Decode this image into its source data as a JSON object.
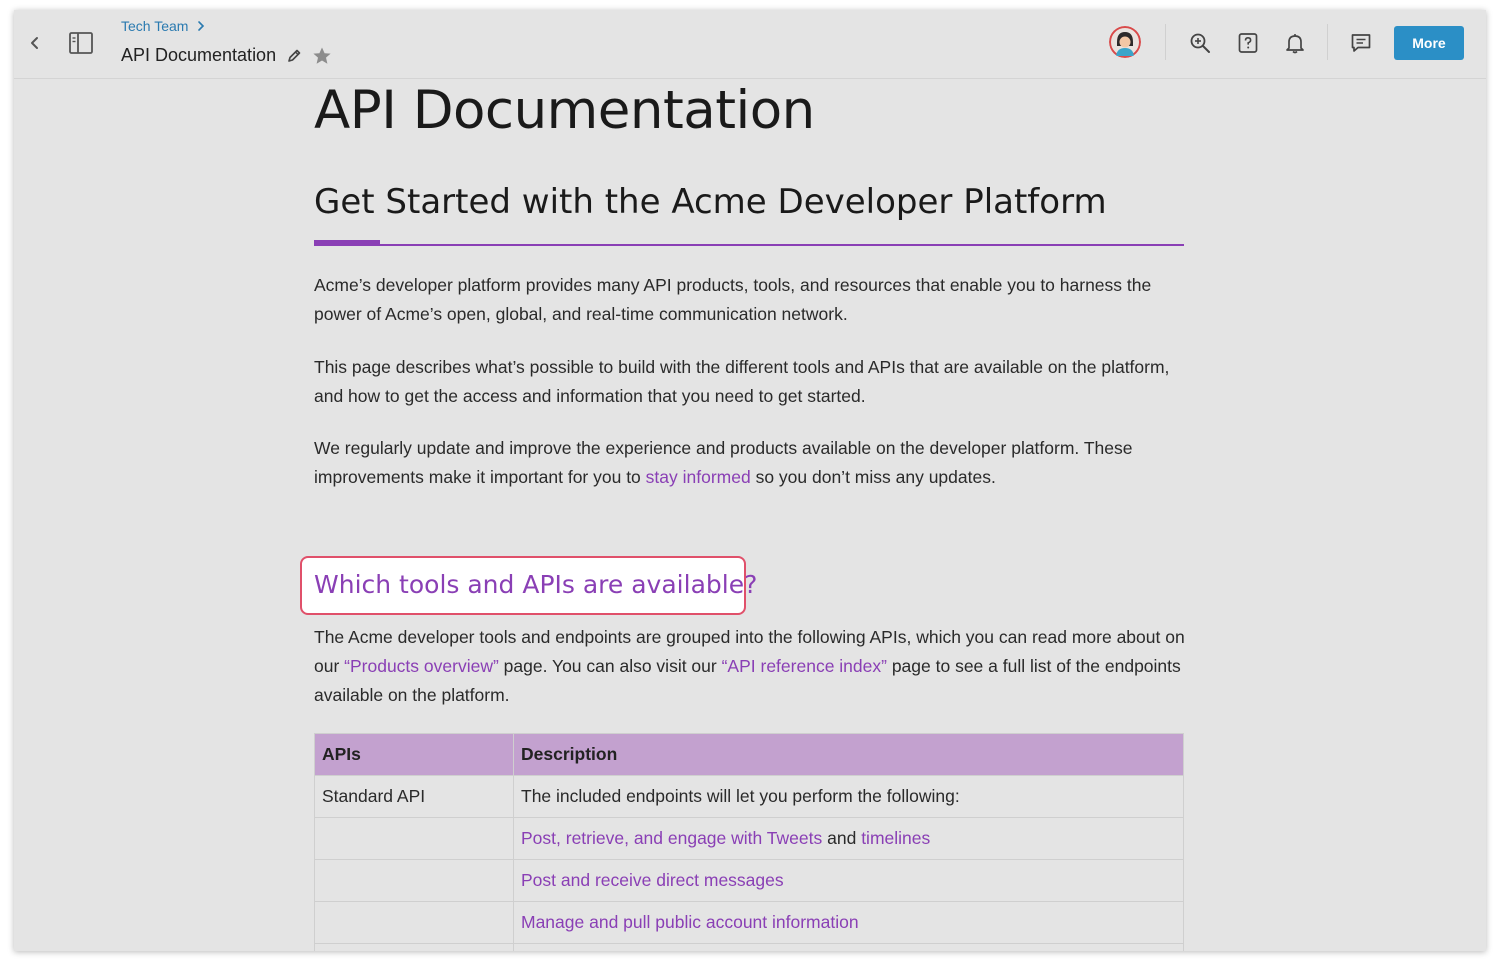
{
  "header": {
    "breadcrumb": "Tech Team",
    "title": "API Documentation",
    "more_label": "More"
  },
  "colors": {
    "accent": "#8a3fb5",
    "primary_button": "#2b8fc6",
    "table_header": "#c3a1cf",
    "callout_border": "#e0506a"
  },
  "icons": [
    "back-icon",
    "sidebar-toggle-icon",
    "chevron-right-icon",
    "edit-icon",
    "star-icon",
    "avatar",
    "zoom-in-icon",
    "help-icon",
    "bell-icon",
    "comment-icon"
  ],
  "doc": {
    "h1": "API Documentation",
    "h2": "Get Started with the Acme Developer Platform",
    "p1": "Acme’s developer platform provides many API products, tools, and resources that enable you to harness the power of Acme’s open, global, and real-time communication network.",
    "p2": "This page describes what’s possible to build with the different tools and APIs that are available on the platform, and how to get the access and information that you need to get started.",
    "p3_before": "We regularly update and improve the experience and products available on the developer platform. These improvements make it important for you to ",
    "p3_link": "stay informed",
    "p3_after": " so you don’t miss any updates.",
    "h3": "Which tools and APIs are available?",
    "p4_a": "The Acme developer tools and endpoints are grouped into the following APIs, which you can read more about on our ",
    "p4_link1": "“Products overview”",
    "p4_b": " page. You can also visit our ",
    "p4_link2": "“API reference index”",
    "p4_c": " page to see a full list of the endpoints available on the platform."
  },
  "table": {
    "headers": [
      "APIs",
      "Description"
    ],
    "row1": {
      "api": "Standard API",
      "desc": "The included endpoints will let you perform the following:"
    },
    "row2": {
      "link1": "Post, retrieve, and engage with Tweets",
      "mid": " and ",
      "link2": "timelines"
    },
    "row3": {
      "link": "Post and receive direct messages"
    },
    "row4": {
      "link": "Manage and pull public account information"
    }
  }
}
